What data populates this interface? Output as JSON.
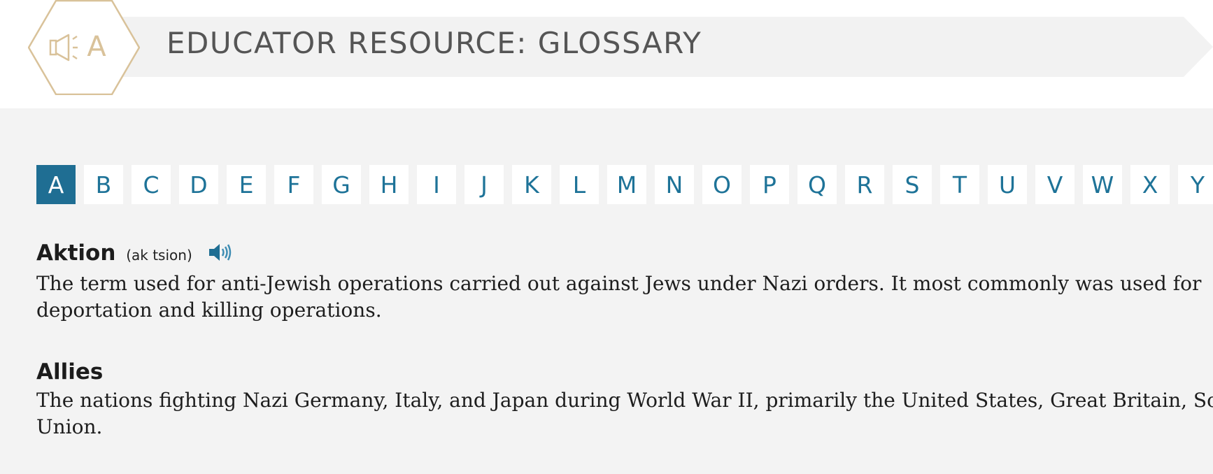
{
  "header": {
    "title": "EDUCATOR RESOURCE: GLOSSARY",
    "logo_icon": "megaphone-a-hex-icon",
    "logo_letter": "A"
  },
  "alphabet": {
    "letters": [
      "A",
      "B",
      "C",
      "D",
      "E",
      "F",
      "G",
      "H",
      "I",
      "J",
      "K",
      "L",
      "M",
      "N",
      "O",
      "P",
      "Q",
      "R",
      "S",
      "T",
      "U",
      "V",
      "W",
      "X",
      "Y"
    ],
    "active": "A"
  },
  "entries": [
    {
      "term": "Aktion",
      "pronunciation": "(ak tsion)",
      "audio_icon": "speaker-icon",
      "definition": "The term used for anti-Jewish operations carried out against Jews under Nazi orders. It most commonly was used for deportation and killing operations."
    },
    {
      "term": "Allies",
      "definition": "The nations fighting Nazi Germany, Italy, and Japan during World War II, primarily the United States, Great Britain, Soviet Union."
    }
  ],
  "colors": {
    "accent": "#1f6e93",
    "link": "#1e7398",
    "logo_gold": "#d9c29a",
    "background": "#f3f3f3"
  }
}
